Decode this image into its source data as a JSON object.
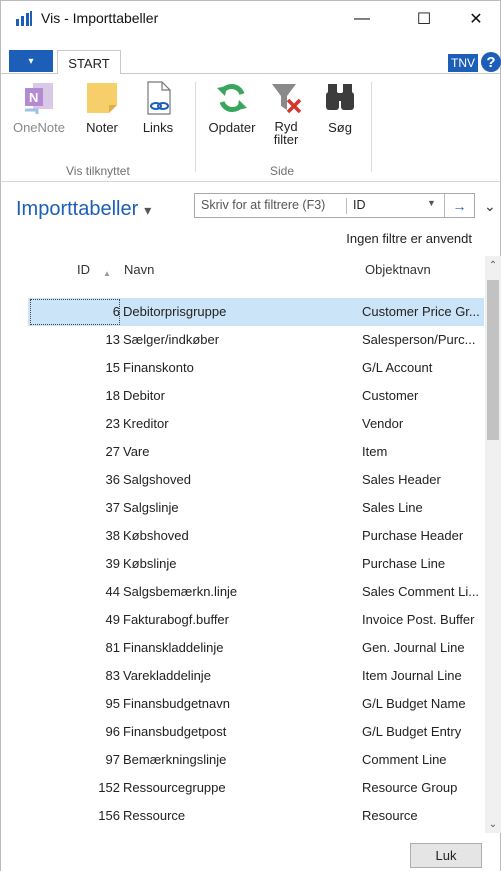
{
  "window": {
    "title": "Vis - Importtabeller",
    "minimize": "—",
    "maximize": "☐",
    "close": "✕"
  },
  "ribbon": {
    "file_tab": "▾",
    "start_tab": "START",
    "user_badge": "TNV",
    "help": "?",
    "buttons": {
      "onenote": "OneNote",
      "noter": "Noter",
      "links": "Links",
      "opdater": "Opdater",
      "ryd_filter": "Ryd filter",
      "soeg": "Søg"
    },
    "groups": {
      "vis_tilknyttet": "Vis tilknyttet",
      "side": "Side"
    }
  },
  "page": {
    "title": "Importtabeller",
    "title_caret": "▾",
    "filter_placeholder": "Skriv for at filtrere (F3)",
    "filter_field": "ID",
    "filter_status": "Ingen filtre er anvendt",
    "collapse": "⌄"
  },
  "table": {
    "headers": {
      "id": "ID",
      "name": "Navn",
      "object": "Objektnavn"
    },
    "rows": [
      {
        "id": "6",
        "name": "Debitorprisgruppe",
        "object": "Customer Price Gr..."
      },
      {
        "id": "13",
        "name": "Sælger/indkøber",
        "object": "Salesperson/Purc..."
      },
      {
        "id": "15",
        "name": "Finanskonto",
        "object": "G/L Account"
      },
      {
        "id": "18",
        "name": "Debitor",
        "object": "Customer"
      },
      {
        "id": "23",
        "name": "Kreditor",
        "object": "Vendor"
      },
      {
        "id": "27",
        "name": "Vare",
        "object": "Item"
      },
      {
        "id": "36",
        "name": "Salgshoved",
        "object": "Sales Header"
      },
      {
        "id": "37",
        "name": "Salgslinje",
        "object": "Sales Line"
      },
      {
        "id": "38",
        "name": "Købshoved",
        "object": "Purchase Header"
      },
      {
        "id": "39",
        "name": "Købslinje",
        "object": "Purchase Line"
      },
      {
        "id": "44",
        "name": "Salgsbemærkn.linje",
        "object": "Sales Comment Li..."
      },
      {
        "id": "49",
        "name": "Fakturabogf.buffer",
        "object": "Invoice Post. Buffer"
      },
      {
        "id": "81",
        "name": "Finanskladdelinje",
        "object": "Gen. Journal Line"
      },
      {
        "id": "83",
        "name": "Varekladdelinje",
        "object": "Item Journal Line"
      },
      {
        "id": "95",
        "name": "Finansbudgetnavn",
        "object": "G/L Budget Name"
      },
      {
        "id": "96",
        "name": "Finansbudgetpost",
        "object": "G/L Budget Entry"
      },
      {
        "id": "97",
        "name": "Bemærkningslinje",
        "object": "Comment Line"
      },
      {
        "id": "152",
        "name": "Ressourcegruppe",
        "object": "Resource Group"
      },
      {
        "id": "156",
        "name": "Ressource",
        "object": "Resource"
      }
    ]
  },
  "footer": {
    "close_button": "Luk"
  },
  "colors": {
    "accent": "#1d5fb8",
    "selected_row": "#cce4f7"
  }
}
